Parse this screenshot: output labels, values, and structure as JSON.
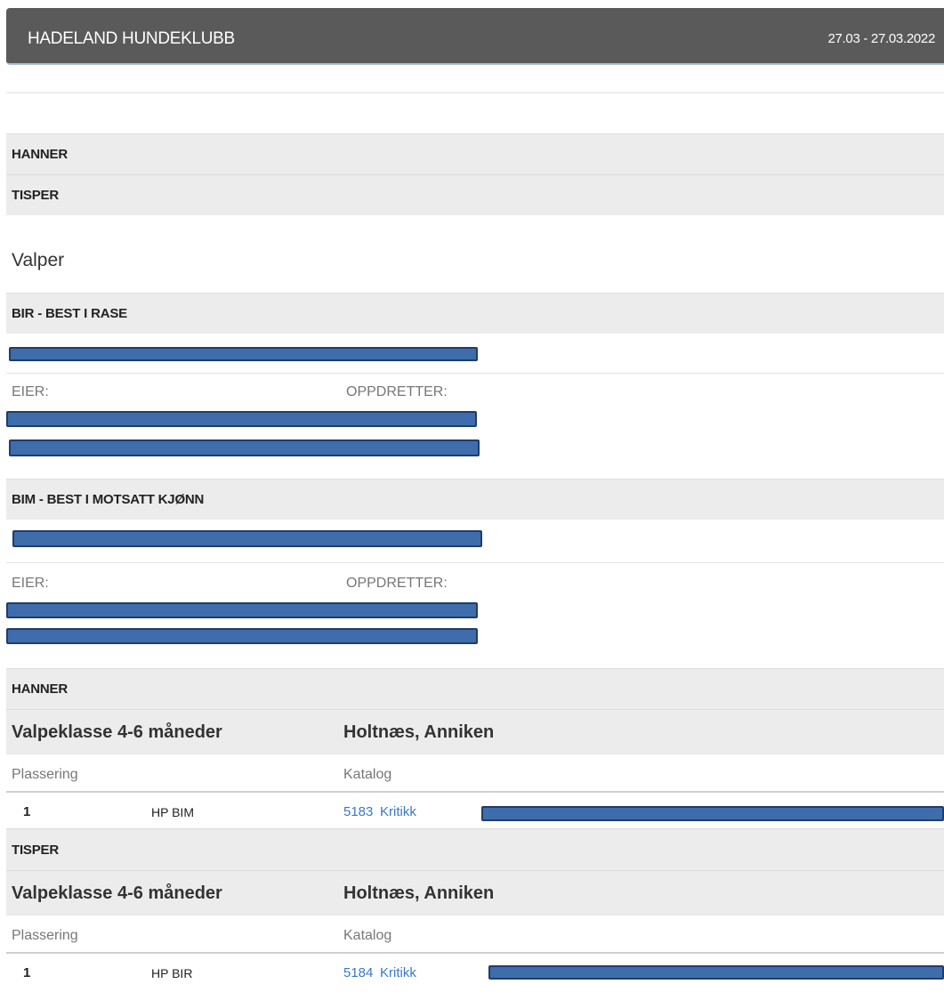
{
  "header": {
    "title": "HADELAND HUNDEKLUBB",
    "dates": "27.03 - 27.03.2022"
  },
  "top_sections": [
    "HANNER",
    "TISPER"
  ],
  "valper_heading": "Valper",
  "bir": {
    "title": "BIR - BEST I RASE",
    "eier_label": "EIER:",
    "oppdretter_label": "OPPDRETTER:"
  },
  "bim": {
    "title": "BIM - BEST I MOTSATT KJØNN",
    "eier_label": "EIER:",
    "oppdretter_label": "OPPDRETTER:"
  },
  "hanner": {
    "title": "HANNER",
    "class_name": "Valpeklasse 4-6 måneder",
    "judge": "Holtnæs, Anniken",
    "col_plassering": "Plassering",
    "col_katalog": "Katalog",
    "entry": {
      "place": "1",
      "award": "HP BIM",
      "catalog": "5183",
      "critique": "Kritikk"
    }
  },
  "tisper": {
    "title": "TISPER",
    "class_name": "Valpeklasse 4-6 måneder",
    "judge": "Holtnæs, Anniken",
    "col_plassering": "Plassering",
    "col_katalog": "Katalog",
    "entry": {
      "place": "1",
      "award": "HP BIR",
      "catalog": "5184",
      "critique": "Kritikk"
    }
  },
  "colors": {
    "header_bg": "#5a5a5a",
    "section_bg": "#ececec",
    "link": "#3a78c3",
    "redaction": "#3f6dab"
  }
}
